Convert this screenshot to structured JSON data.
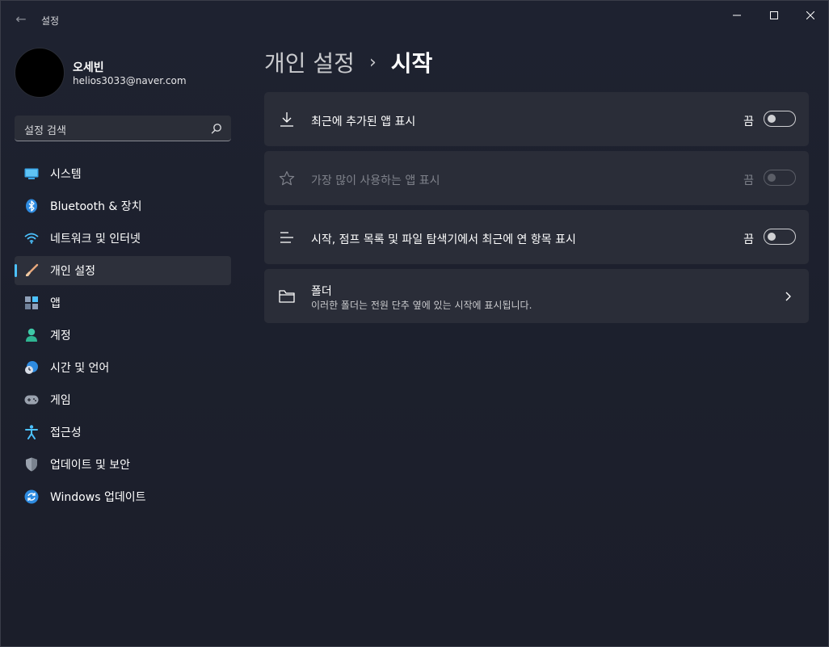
{
  "app": {
    "title": "설정"
  },
  "profile": {
    "name": "오세빈",
    "email": "helios3033@naver.com"
  },
  "search": {
    "placeholder": "설정 검색"
  },
  "nav": {
    "items": [
      {
        "label": "시스템",
        "icon": "system-icon",
        "active": false
      },
      {
        "label": "Bluetooth & 장치",
        "icon": "bluetooth-icon",
        "active": false
      },
      {
        "label": "네트워크 및 인터넷",
        "icon": "wifi-icon",
        "active": false
      },
      {
        "label": "개인 설정",
        "icon": "brush-icon",
        "active": true
      },
      {
        "label": "앱",
        "icon": "apps-icon",
        "active": false
      },
      {
        "label": "계정",
        "icon": "person-icon",
        "active": false
      },
      {
        "label": "시간 및 언어",
        "icon": "clock-globe-icon",
        "active": false
      },
      {
        "label": "게임",
        "icon": "gamepad-icon",
        "active": false
      },
      {
        "label": "접근성",
        "icon": "accessibility-icon",
        "active": false
      },
      {
        "label": "업데이트 및 보안",
        "icon": "shield-icon",
        "active": false
      },
      {
        "label": "Windows 업데이트",
        "icon": "sync-icon",
        "active": false
      }
    ]
  },
  "breadcrumb": {
    "parent": "개인 설정",
    "separator": "›",
    "current": "시작"
  },
  "settings": {
    "recent_apps": {
      "title": "최근에 추가된 앱 표시",
      "state": "끔",
      "enabled": true,
      "on": false
    },
    "most_used": {
      "title": "가장 많이 사용하는 앱 표시",
      "state": "끔",
      "enabled": false,
      "on": false
    },
    "recent_items": {
      "title": "시작, 점프 목록 및 파일 탐색기에서 최근에 연 항목 표시",
      "state": "끔",
      "enabled": true,
      "on": false
    },
    "folders": {
      "title": "폴더",
      "subtitle": "이러한 폴더는 전원 단추 옆에 있는 시작에 표시됩니다."
    }
  },
  "colors": {
    "accent": "#4cc2ff",
    "background": "#1c1f2a",
    "card": "#2a2d38"
  }
}
